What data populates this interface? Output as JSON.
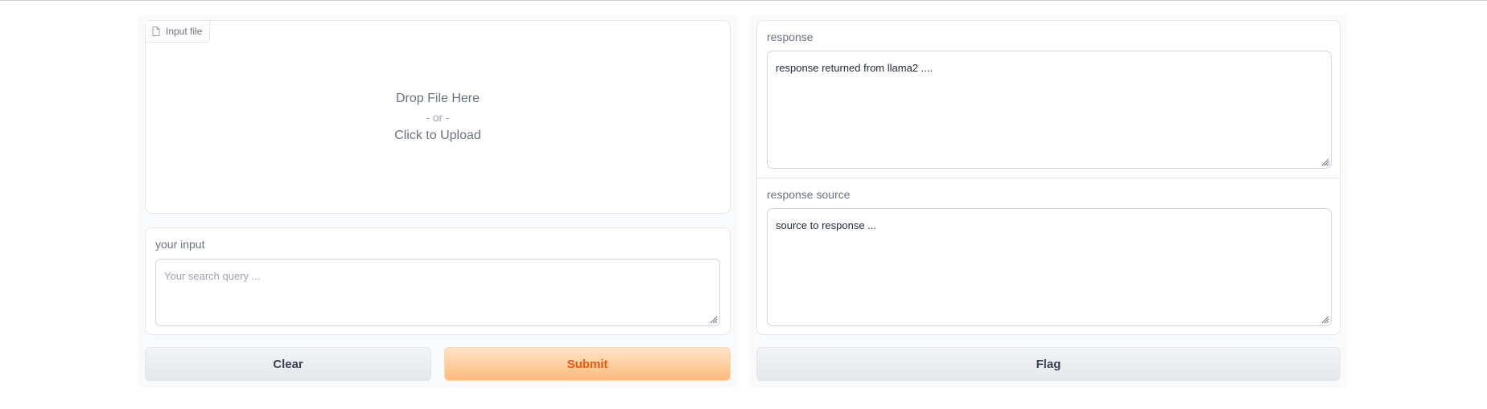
{
  "left": {
    "upload": {
      "tab_label": "Input file",
      "drop_text": "Drop File Here",
      "or_text": "- or -",
      "click_text": "Click to Upload"
    },
    "input": {
      "label": "your input",
      "placeholder": "Your search query ..."
    },
    "buttons": {
      "clear": "Clear",
      "submit": "Submit"
    }
  },
  "right": {
    "response": {
      "label": "response",
      "value": "response returned from llama2 ...."
    },
    "source": {
      "label": "response source",
      "value": "source to response ..."
    },
    "buttons": {
      "flag": "Flag"
    }
  },
  "colors": {
    "accent": "#ea580c",
    "submit_bg_top": "#fee4c6",
    "submit_bg_bottom": "#fdbb7d"
  }
}
